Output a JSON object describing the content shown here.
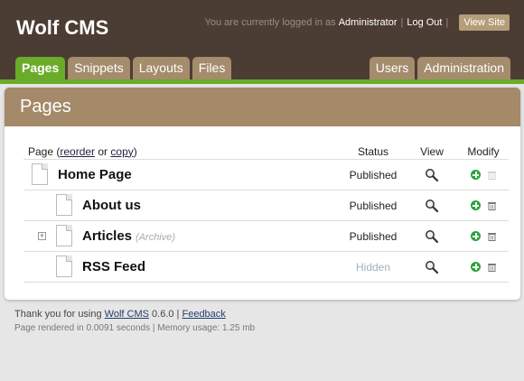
{
  "header": {
    "logo": "Wolf CMS",
    "logged_in_text": "You are currently logged in as",
    "user": "Administrator",
    "separator": "|",
    "logout": "Log Out",
    "view_site": "View Site"
  },
  "tabs_left": [
    {
      "label": "Pages",
      "active": true
    },
    {
      "label": "Snippets"
    },
    {
      "label": "Layouts"
    },
    {
      "label": "Files"
    }
  ],
  "tabs_right": [
    {
      "label": "Users"
    },
    {
      "label": "Administration"
    }
  ],
  "panel": {
    "title": "Pages",
    "columns": {
      "page": "Page (",
      "reorder": "reorder",
      "or": " or ",
      "copy": "copy",
      "close": ")",
      "status": "Status",
      "view": "View",
      "modify": "Modify"
    },
    "rows": [
      {
        "name": "Home Page",
        "status": "Published"
      },
      {
        "name": "About us",
        "status": "Published"
      },
      {
        "name": "Articles",
        "tag": "(Archive)",
        "status": "Published"
      },
      {
        "name": "RSS Feed",
        "status": "Hidden"
      }
    ]
  },
  "footer": {
    "thanks": "Thank you for using ",
    "product_link": "Wolf CMS",
    "version": " 0.6.0 | ",
    "feedback": "Feedback",
    "render_info": "Page rendered in 0.0091 seconds | Memory usage: 1.25 mb"
  },
  "colors": {
    "header_bg": "#4b3d33",
    "accent_green": "#6bab2a",
    "tab_tan": "#a48c6c"
  }
}
